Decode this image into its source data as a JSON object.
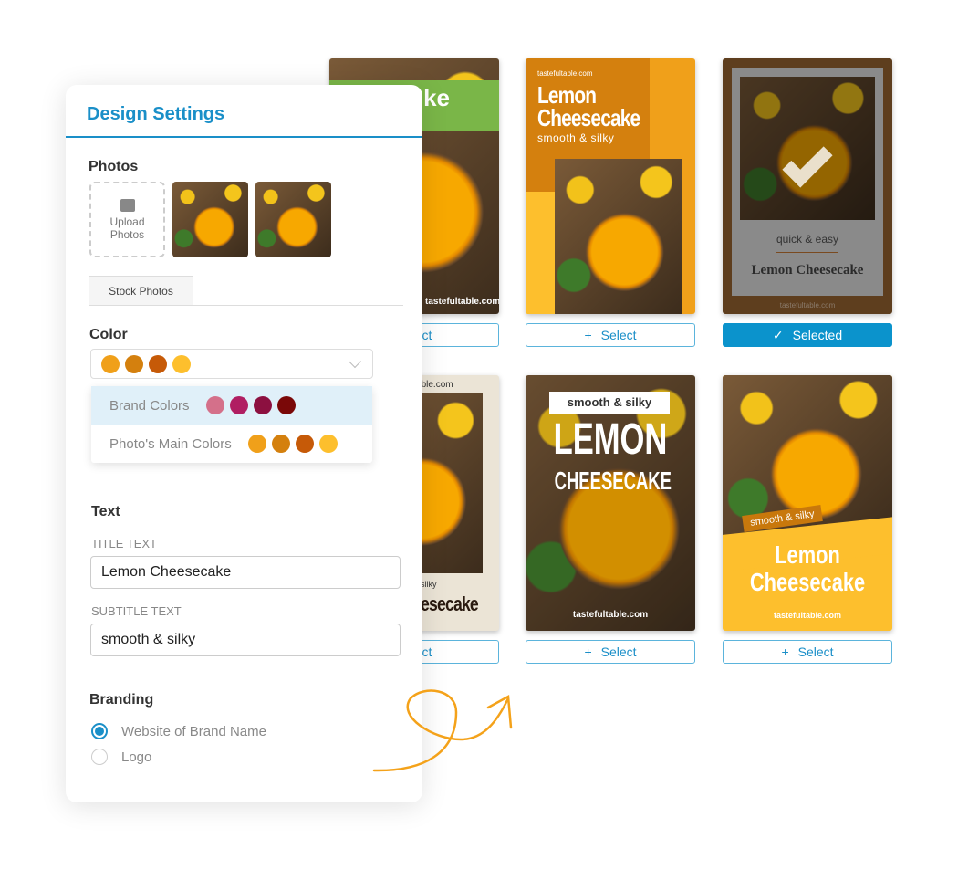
{
  "panel": {
    "title": "Design Settings",
    "photos": {
      "heading": "Photos",
      "upload_label": "Upload Photos",
      "stock_tab": "Stock Photos"
    },
    "color": {
      "heading": "Color",
      "selected": [
        "#f0a01a",
        "#d4800e",
        "#c65a08",
        "#fdbf2d"
      ],
      "options": [
        {
          "label": "Brand Colors",
          "colors": [
            "#d4708a",
            "#b01e62",
            "#8c1040",
            "#7a0808"
          ],
          "highlighted": true
        },
        {
          "label": "Photo's Main Colors",
          "colors": [
            "#f0a01a",
            "#d4800e",
            "#c65a08",
            "#fdbf2d"
          ],
          "highlighted": false
        }
      ]
    },
    "text": {
      "heading": "Text",
      "title_label": "TITLE TEXT",
      "title_value": "Lemon Cheesecake",
      "subtitle_label": "SUBTITLE TEXT",
      "subtitle_value": "smooth & silky"
    },
    "branding": {
      "heading": "Branding",
      "options": [
        {
          "label": "Website of Brand Name",
          "checked": true
        },
        {
          "label": "Logo",
          "checked": false
        }
      ]
    }
  },
  "templates": {
    "site": "tastefultable.com",
    "title": "Lemon Cheesecake",
    "title_line1": "Lemon",
    "title_line2": "Cheesecake",
    "title_upper1": "LEMON",
    "title_upper2": "CHEESECAKE",
    "subtitle": "smooth & silky",
    "alt_subtitle": "quick & easy",
    "partial_title": "ke",
    "partial_site": "le.com",
    "partial_sub": "silky",
    "partial_title2": "esecake",
    "select_label": "Select",
    "selected_label": "Selected",
    "partial_select": "ect"
  },
  "accent": "#0b93cc"
}
